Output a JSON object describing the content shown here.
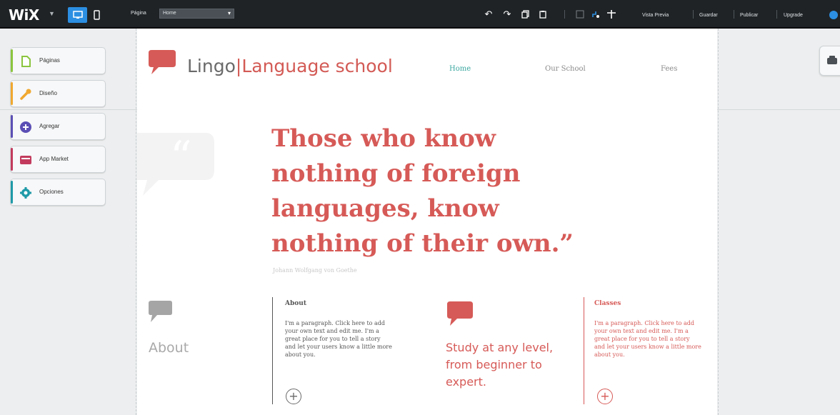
{
  "topbar": {
    "logo": "WiX",
    "pages_label": "Página",
    "pages_value": "Home",
    "actions": [
      "Vista Previa",
      "Guardar",
      "Publicar",
      "Upgrade"
    ]
  },
  "sidebar": {
    "items": [
      {
        "label": "Páginas",
        "icon": "page-icon",
        "color": "#8bc53f"
      },
      {
        "label": "Diseño",
        "icon": "brush-icon",
        "color": "#f0a830"
      },
      {
        "label": "Agregar",
        "icon": "plus-circle-icon",
        "color": "#5b4fb5"
      },
      {
        "label": "App Market",
        "icon": "app-market-icon",
        "color": "#c23b5e"
      },
      {
        "label": "Opciones",
        "icon": "gear-icon",
        "color": "#1f9aa8"
      }
    ]
  },
  "site": {
    "brand_name": "Lingo",
    "brand_sub": "Language school",
    "nav": [
      "Home",
      "Our School",
      "Fees"
    ],
    "quote": "Those who know nothing of foreign languages, know nothing of their own.”",
    "author": "Johann Wolfgang von Goethe",
    "about_title": "About",
    "col1_title": "About",
    "col1_body": "I'm a paragraph. Click here to add your own text and edit me. I'm a great place for you to tell a story and let your users know a little more about you.",
    "study_text": "Study at any level, from beginner to expert.",
    "col3_title": "Classes",
    "col3_body": "I'm a paragraph. Click here to add your own text and edit me. I'm a great place for you to tell a story and let your users know a little more about you."
  },
  "colors": {
    "accent_red": "#d65a57",
    "nav_active": "#3aa7a0",
    "topbar_bg": "#1f2326",
    "wix_blue": "#2c8fe2"
  }
}
